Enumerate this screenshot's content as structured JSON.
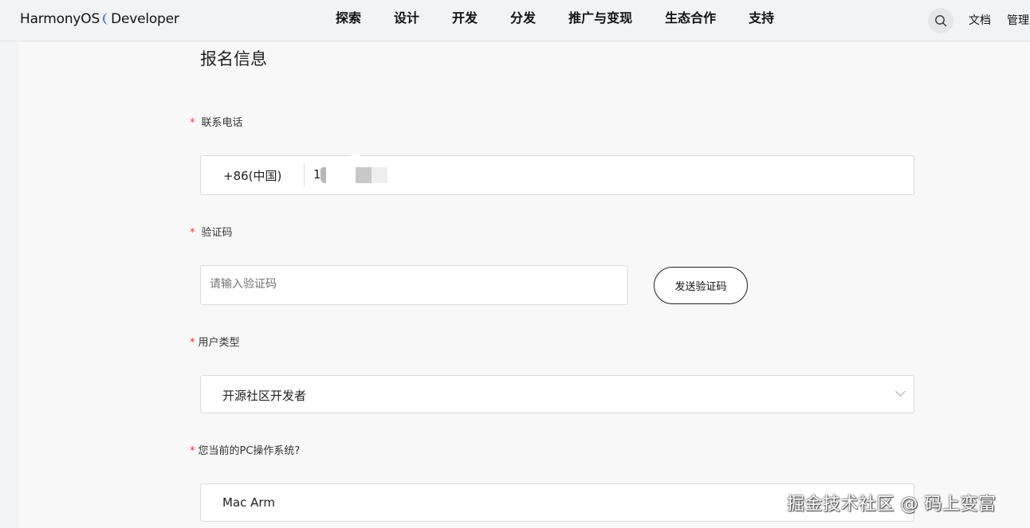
{
  "header": {
    "logo_text": "HarmonyOS Developer",
    "logo_part1": "HarmonyOS",
    "logo_part2": "Developer",
    "nav": [
      "探索",
      "设计",
      "开发",
      "分发",
      "推广与变现",
      "生态合作",
      "支持"
    ],
    "search_icon": "search-icon",
    "docs_label": "文档",
    "manage_label": "管理"
  },
  "form": {
    "title": "报名信息",
    "phone": {
      "label": "联系电话",
      "prefix": "+86(中国)",
      "value": "1"
    },
    "code": {
      "label": "验证码",
      "placeholder": "请输入验证码",
      "send_label": "发送验证码"
    },
    "user_type": {
      "label": "用户类型",
      "value": "开源社区开发者"
    },
    "os": {
      "label": "您当前的PC操作系统?",
      "value": "Mac Arm"
    },
    "required_mark": "*"
  },
  "watermark": "掘金技术社区 @ 码上变富",
  "colors": {
    "required": "#e53935",
    "background": "#f8f8f8",
    "header_bg": "#f1f3f5",
    "logo_accent": "#4a6cf7"
  }
}
